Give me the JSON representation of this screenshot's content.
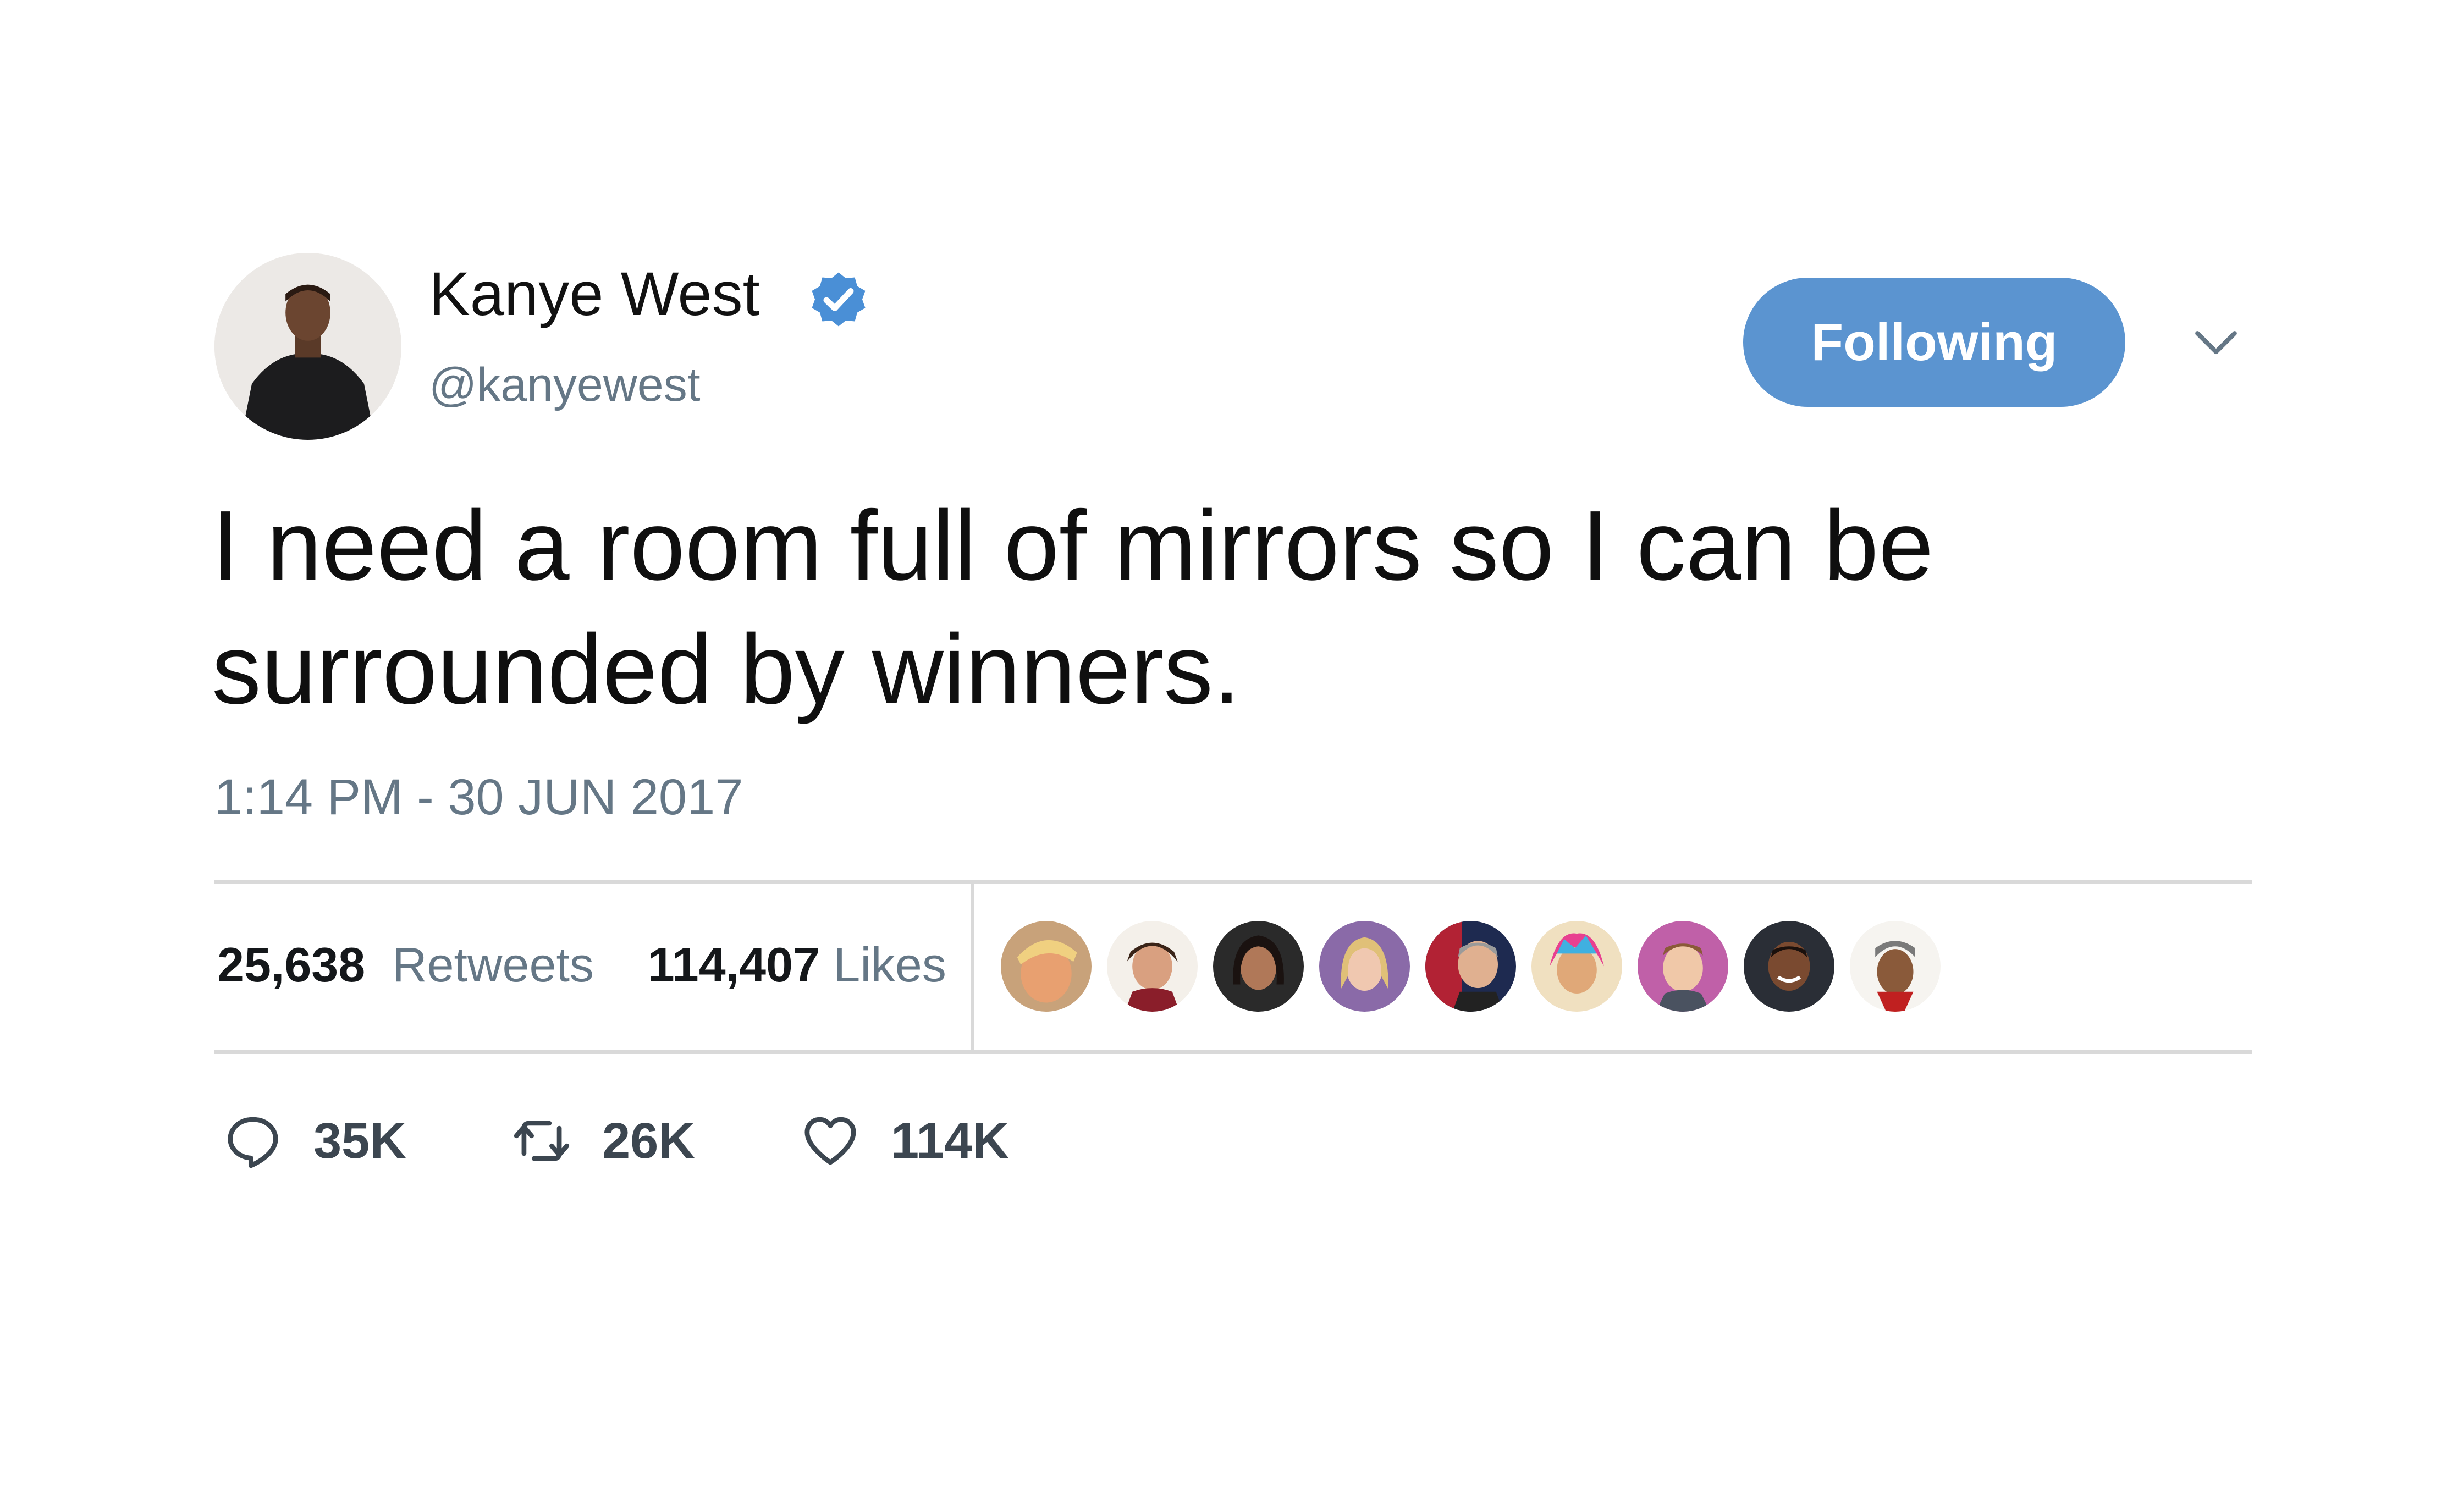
{
  "user": {
    "name": "Kanye West",
    "handle": "@kanyewest",
    "verified": true
  },
  "follow_button": {
    "label": "Following"
  },
  "tweet": {
    "text_line1": "I need a room full of mirrors so I can be",
    "text_line2": "surrounded by winners.",
    "timestamp": "1:14 PM - 30 JUN 2017"
  },
  "stats": {
    "retweets_count": "25,638",
    "retweets_label": "Retweets",
    "likes_count": "114,407",
    "likes_label": "Likes"
  },
  "liked_by_avatars": [
    "avatar-1",
    "avatar-2",
    "avatar-3",
    "avatar-4",
    "avatar-5",
    "avatar-6",
    "avatar-7",
    "avatar-8",
    "avatar-9"
  ],
  "actions": {
    "replies": "35K",
    "retweets": "26K",
    "likes": "114K"
  },
  "colors": {
    "accent": "#5b94d0",
    "verified": "#4a8fd6",
    "muted_text": "#657786",
    "divider": "#d9d9d9"
  }
}
